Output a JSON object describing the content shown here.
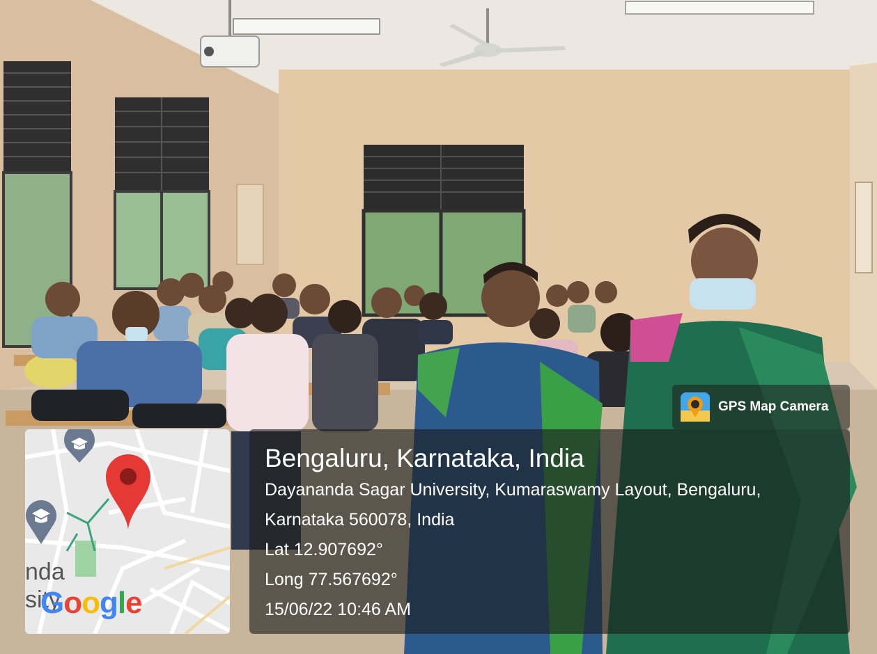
{
  "photo": {
    "scene": "classroom group photo"
  },
  "overlay": {
    "app_badge": {
      "icon": "gps-map-camera-icon",
      "label": "GPS Map Camera"
    },
    "map": {
      "pin_icon": "map-pin-icon",
      "poi_icon": "graduation-cap-icon",
      "partial_place_label_1": "nda",
      "partial_place_label_2": "sity",
      "brand_letters": [
        "G",
        "o",
        "o",
        "g",
        "l",
        "e"
      ],
      "brand_colors": [
        "#4285F4",
        "#EA4335",
        "#FBBC05",
        "#4285F4",
        "#34A853",
        "#EA4335"
      ]
    },
    "location": {
      "headline": "Bengaluru, Karnataka, India",
      "address_line_1": "Dayananda Sagar University, Kumaraswamy Layout, Bengaluru,",
      "address_line_2": "Karnataka 560078, India",
      "lat": "Lat 12.907692°",
      "long": "Long 77.567692°",
      "datetime": "15/06/22 10:46 AM"
    }
  }
}
